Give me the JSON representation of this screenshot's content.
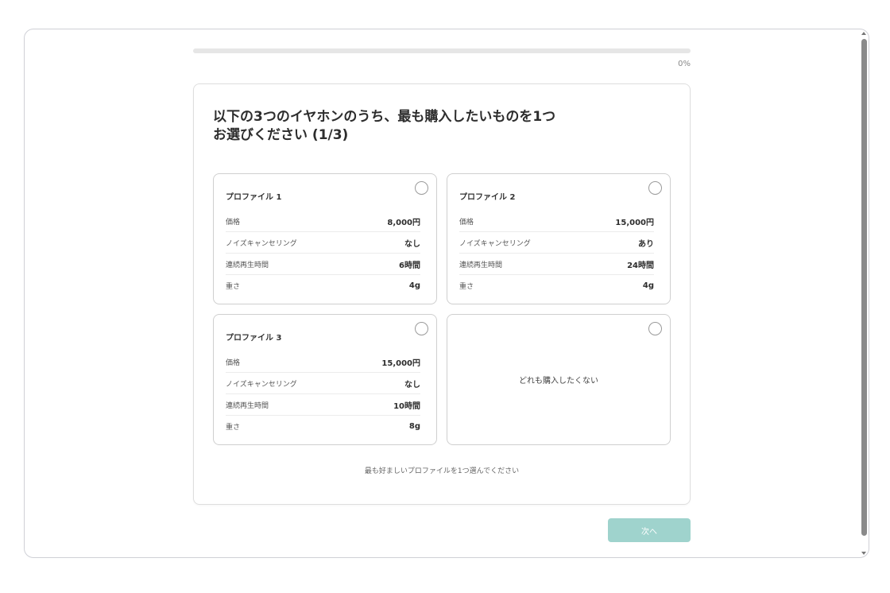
{
  "progress": {
    "label": "0%",
    "fraction": 0
  },
  "question": {
    "title_line1": "以下の3つのイヤホンのうち、最も購入したいものを1つ",
    "title_line2": "お選びください (1/3)"
  },
  "attribute_labels": [
    "価格",
    "ノイズキャンセリング",
    "連続再生時間",
    "重さ"
  ],
  "profiles": [
    {
      "title": "プロファイル 1",
      "values": [
        "8,000円",
        "なし",
        "6時間",
        "4g"
      ]
    },
    {
      "title": "プロファイル 2",
      "values": [
        "15,000円",
        "あり",
        "24時間",
        "4g"
      ]
    },
    {
      "title": "プロファイル 3",
      "values": [
        "15,000円",
        "なし",
        "10時間",
        "8g"
      ]
    }
  ],
  "none_option": {
    "label": "どれも購入したくない"
  },
  "instruction": "最も好ましいプロファイルを1つ選んでください",
  "next_button": {
    "label": "次へ"
  },
  "colors": {
    "accent": "#9fd3cd",
    "border": "#cfcfcf",
    "progress_track": "#e6e6e6"
  }
}
